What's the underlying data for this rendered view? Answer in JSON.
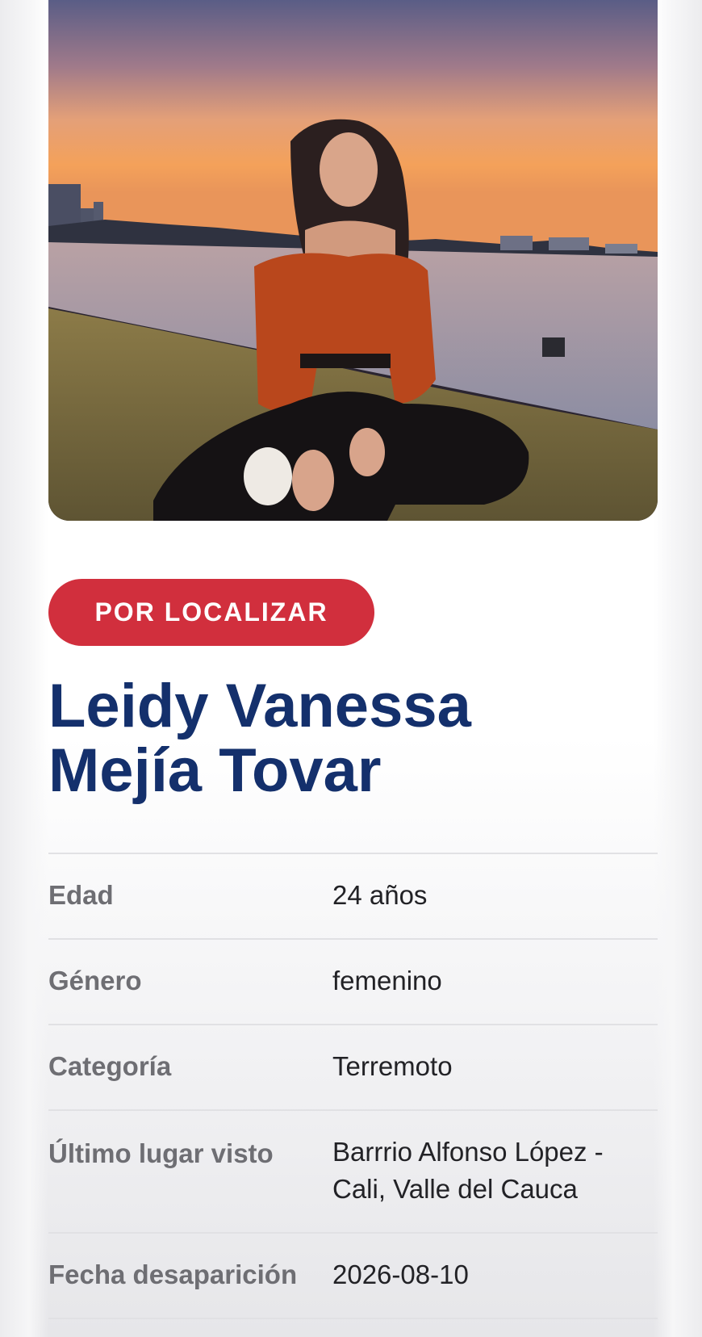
{
  "status": {
    "label": "POR LOCALIZAR",
    "color": "#d12f3d"
  },
  "person": {
    "name_line1": "Leidy Vanessa",
    "name_line2": "Mejía Tovar",
    "name_color": "#14306c"
  },
  "photo": {
    "description_icon": "portrait-photo"
  },
  "details": [
    {
      "label": "Edad",
      "value": "24 años"
    },
    {
      "label": "Género",
      "value": "femenino"
    },
    {
      "label": "Categoría",
      "value": "Terremoto"
    },
    {
      "label": "Último lugar visto",
      "value_line1": "Barrrio Alfonso López -",
      "value_line2": "Cali, Valle del Cauca"
    },
    {
      "label": "Fecha desaparición",
      "value": "2026-08-10"
    }
  ]
}
